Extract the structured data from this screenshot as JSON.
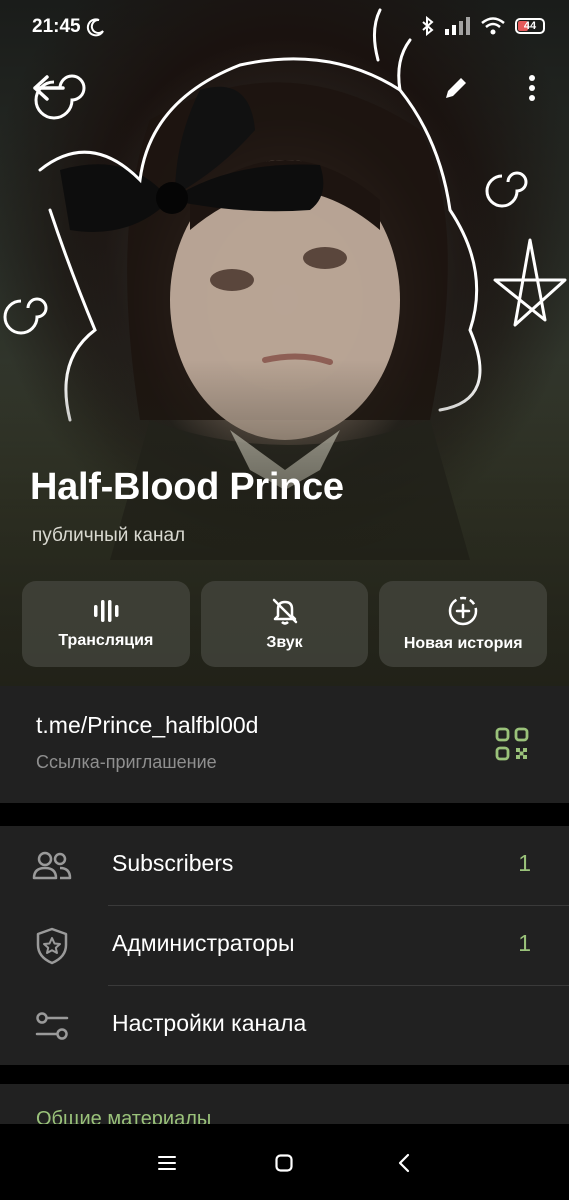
{
  "status_bar": {
    "time": "21:45",
    "battery": "44",
    "icons": [
      "moon-icon",
      "bluetooth-icon",
      "signal-icon",
      "wifi-icon",
      "battery-icon"
    ]
  },
  "header": {
    "title": "Half-Blood Prince",
    "subtitle": "публичный канал",
    "icons": [
      "back-arrow-icon",
      "pencil-icon",
      "more-vertical-icon"
    ]
  },
  "actions": [
    {
      "label": "Трансляция",
      "icon": "live-stream-icon"
    },
    {
      "label": "Звук",
      "icon": "bell-off-icon"
    },
    {
      "label": "Новая история",
      "icon": "add-story-icon"
    }
  ],
  "link": {
    "url": "t.me/Prince_halfbl00d",
    "caption": "Ссылка-приглашение",
    "icon": "qr-code-icon"
  },
  "list": [
    {
      "label": "Subscribers",
      "count": "1",
      "icon": "users-icon"
    },
    {
      "label": "Администраторы",
      "count": "1",
      "icon": "shield-star-icon"
    },
    {
      "label": "Настройки канала",
      "count": "",
      "icon": "sliders-icon"
    }
  ],
  "shared": {
    "title": "Общие материалы"
  },
  "colors": {
    "accent": "#9ac27a",
    "card": "#212121",
    "background": "#000000",
    "muted": "#8f8f8f"
  }
}
